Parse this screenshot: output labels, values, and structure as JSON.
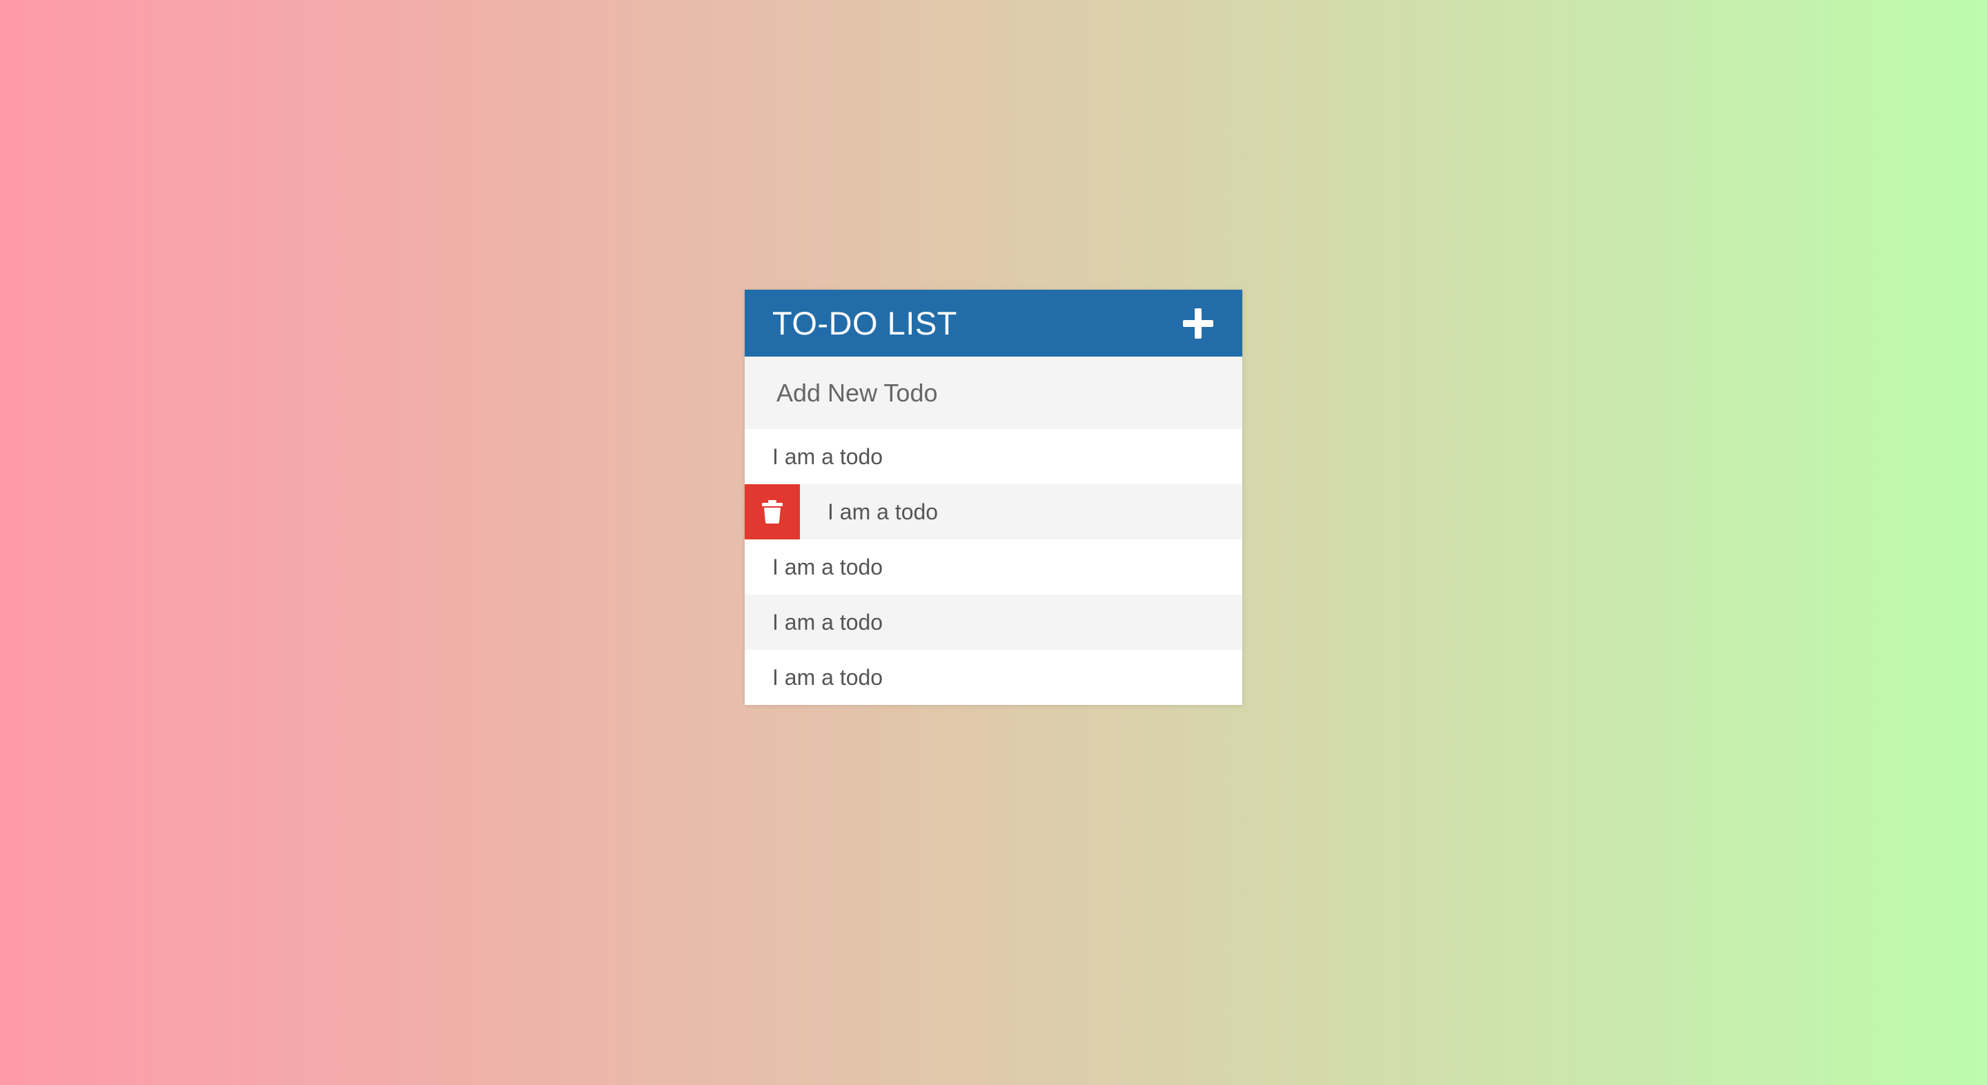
{
  "header": {
    "title": "TO-DO LIST",
    "add_icon": "plus-icon"
  },
  "new_todo": {
    "placeholder": "Add New Todo",
    "value": ""
  },
  "todos": [
    {
      "text": "I am a todo",
      "hovered": false
    },
    {
      "text": "I am a todo",
      "hovered": true
    },
    {
      "text": "I am a todo",
      "hovered": false
    },
    {
      "text": "I am a todo",
      "hovered": false
    },
    {
      "text": "I am a todo",
      "hovered": false
    }
  ],
  "delete_icon": "trash-icon",
  "colors": {
    "header_bg": "#226da9",
    "delete_bg": "#e1392f",
    "gradient_start": "#fe9aaa",
    "gradient_end": "#bdfbae"
  }
}
